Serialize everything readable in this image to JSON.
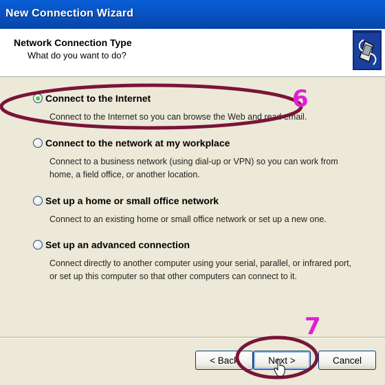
{
  "window": {
    "title": "New Connection Wizard"
  },
  "header": {
    "title": "Network Connection Type",
    "subtitle": "What do you want to do?"
  },
  "options": [
    {
      "label": "Connect to the Internet",
      "description": "Connect to the Internet so you can browse the Web and read email.",
      "selected": true
    },
    {
      "label": "Connect to the network at my workplace",
      "description": "Connect to a business network (using dial-up or VPN) so you can work from home, a field office, or another location.",
      "selected": false
    },
    {
      "label": "Set up a home or small office network",
      "description": "Connect to an existing home or small office network or set up a new one.",
      "selected": false
    },
    {
      "label": "Set up an advanced connection",
      "description": "Connect directly to another computer using your serial, parallel, or infrared port, or set up this computer so that other computers can connect to it.",
      "selected": false
    }
  ],
  "buttons": {
    "back": "< Back",
    "next": "Next >",
    "cancel": "Cancel"
  },
  "annotations": {
    "step6": "6",
    "step7": "7",
    "color": "#e020d0",
    "ellipse_color": "#7a1438"
  },
  "icons": {
    "header": "wizard-connection-icon",
    "cursor": "hand-pointer-icon"
  }
}
